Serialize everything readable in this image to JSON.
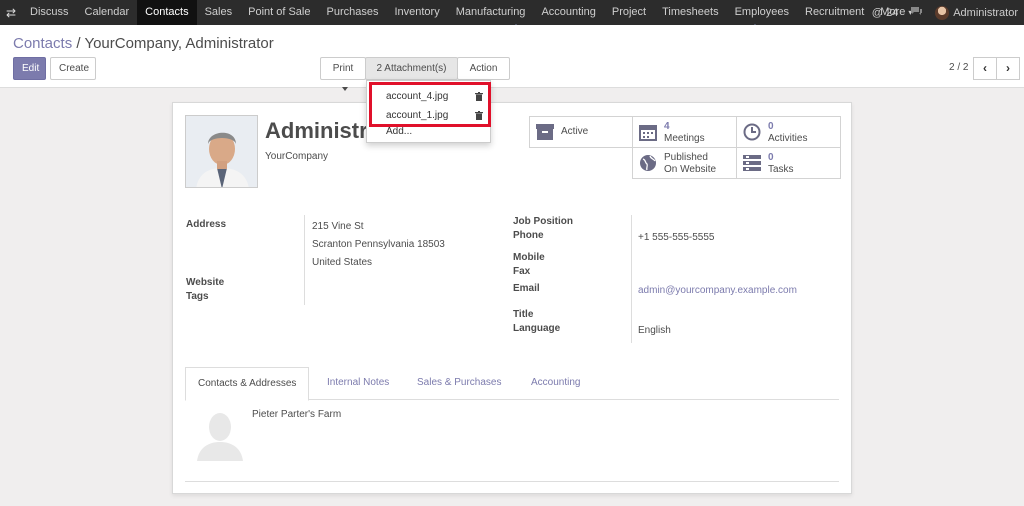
{
  "navbar": {
    "apps": [
      "Discuss",
      "Calendar",
      "Contacts",
      "Sales",
      "Point of Sale",
      "Purchases",
      "Inventory",
      "Manufacturing",
      "Accounting",
      "Project",
      "Timesheets",
      "Employees",
      "Recruitment",
      "More"
    ],
    "active_app": "Contacts",
    "mentions_count": "24",
    "user": "Administrator"
  },
  "breadcrumb": {
    "parent": "Contacts",
    "separator": "/",
    "current": "YourCompany, Administrator"
  },
  "toolbar": {
    "edit_label": "Edit",
    "create_label": "Create",
    "print_label": "Print",
    "attachments_label": "2 Attachment(s)",
    "action_label": "Action"
  },
  "pager": {
    "value": "2 / 2"
  },
  "attachments_menu": {
    "items": [
      "account_4.jpg",
      "account_1.jpg"
    ],
    "add_label": "Add..."
  },
  "partner": {
    "name": "Administrator",
    "company": "YourCompany"
  },
  "smart_buttons": {
    "active": {
      "label": "Active"
    },
    "meetings": {
      "count": "4",
      "label": "Meetings"
    },
    "activities": {
      "count": "0",
      "label": "Activities"
    },
    "website": {
      "line1": "Published",
      "line2": "On Website"
    },
    "tasks": {
      "count": "0",
      "label": "Tasks"
    }
  },
  "fields": {
    "address_label": "Address",
    "street": "215 Vine St",
    "city_state_zip": "Scranton Pennsylvania 18503",
    "country": "United States",
    "website_label": "Website",
    "tags_label": "Tags",
    "job_position_label": "Job Position",
    "phone_label": "Phone",
    "phone": "+1 555-555-5555",
    "mobile_label": "Mobile",
    "fax_label": "Fax",
    "email_label": "Email",
    "email": "admin@yourcompany.example.com",
    "title_label": "Title",
    "language_label": "Language",
    "language": "English"
  },
  "tabs": [
    "Contacts & Addresses",
    "Internal Notes",
    "Sales & Purchases",
    "Accounting"
  ],
  "child_contacts": [
    {
      "name": "Pieter Parter's Farm"
    }
  ],
  "colors": {
    "accent": "#7c7bad",
    "navbar": "#2c2c2c",
    "highlight": "#e0102a"
  }
}
